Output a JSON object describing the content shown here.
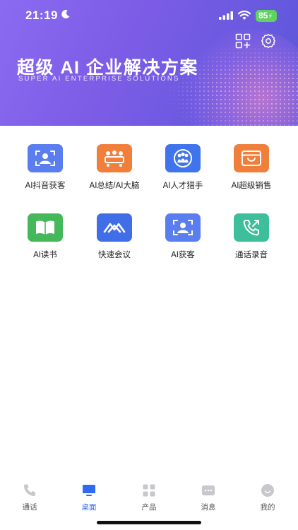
{
  "status_bar": {
    "time": "21:19",
    "battery": "85",
    "icons": [
      "moon-icon",
      "signal-icon",
      "wifi-icon",
      "battery-charging-icon"
    ]
  },
  "header": {
    "title": "超级 AI 企业解决方案",
    "subtitle": "SUPER AI ENTERPRISE SOLUTIONS",
    "actions": [
      "scan-add-icon",
      "settings-icon"
    ]
  },
  "apps": [
    {
      "label": "AI抖音获客",
      "icon": "face-scan-icon",
      "color": "#5a7ef0"
    },
    {
      "label": "AI总结/AI大脑",
      "icon": "meeting-table-icon",
      "color": "#f07f3c"
    },
    {
      "label": "AI人才猎手",
      "icon": "talent-search-icon",
      "color": "#3f74ec"
    },
    {
      "label": "AI超级销售",
      "icon": "smile-window-icon",
      "color": "#f07f3c"
    },
    {
      "label": "AI读书",
      "icon": "open-book-icon",
      "color": "#45b85a"
    },
    {
      "label": "快速会议",
      "icon": "meeting-mountain-icon",
      "color": "#3f6ee8"
    },
    {
      "label": "AI获客",
      "icon": "face-scan-icon",
      "color": "#5a7ef0"
    },
    {
      "label": "通话录音",
      "icon": "phone-call-icon",
      "color": "#3cbf9a"
    }
  ],
  "tabbar": {
    "items": [
      {
        "label": "通话",
        "icon": "phone-icon",
        "active": false
      },
      {
        "label": "桌面",
        "icon": "desktop-icon",
        "active": true
      },
      {
        "label": "产品",
        "icon": "grid-apps-icon",
        "active": false
      },
      {
        "label": "消息",
        "icon": "message-icon",
        "active": false
      },
      {
        "label": "我的",
        "icon": "profile-smile-icon",
        "active": false
      }
    ],
    "active_color": "#2f6bf0",
    "inactive_color": "#c7c7cc"
  }
}
